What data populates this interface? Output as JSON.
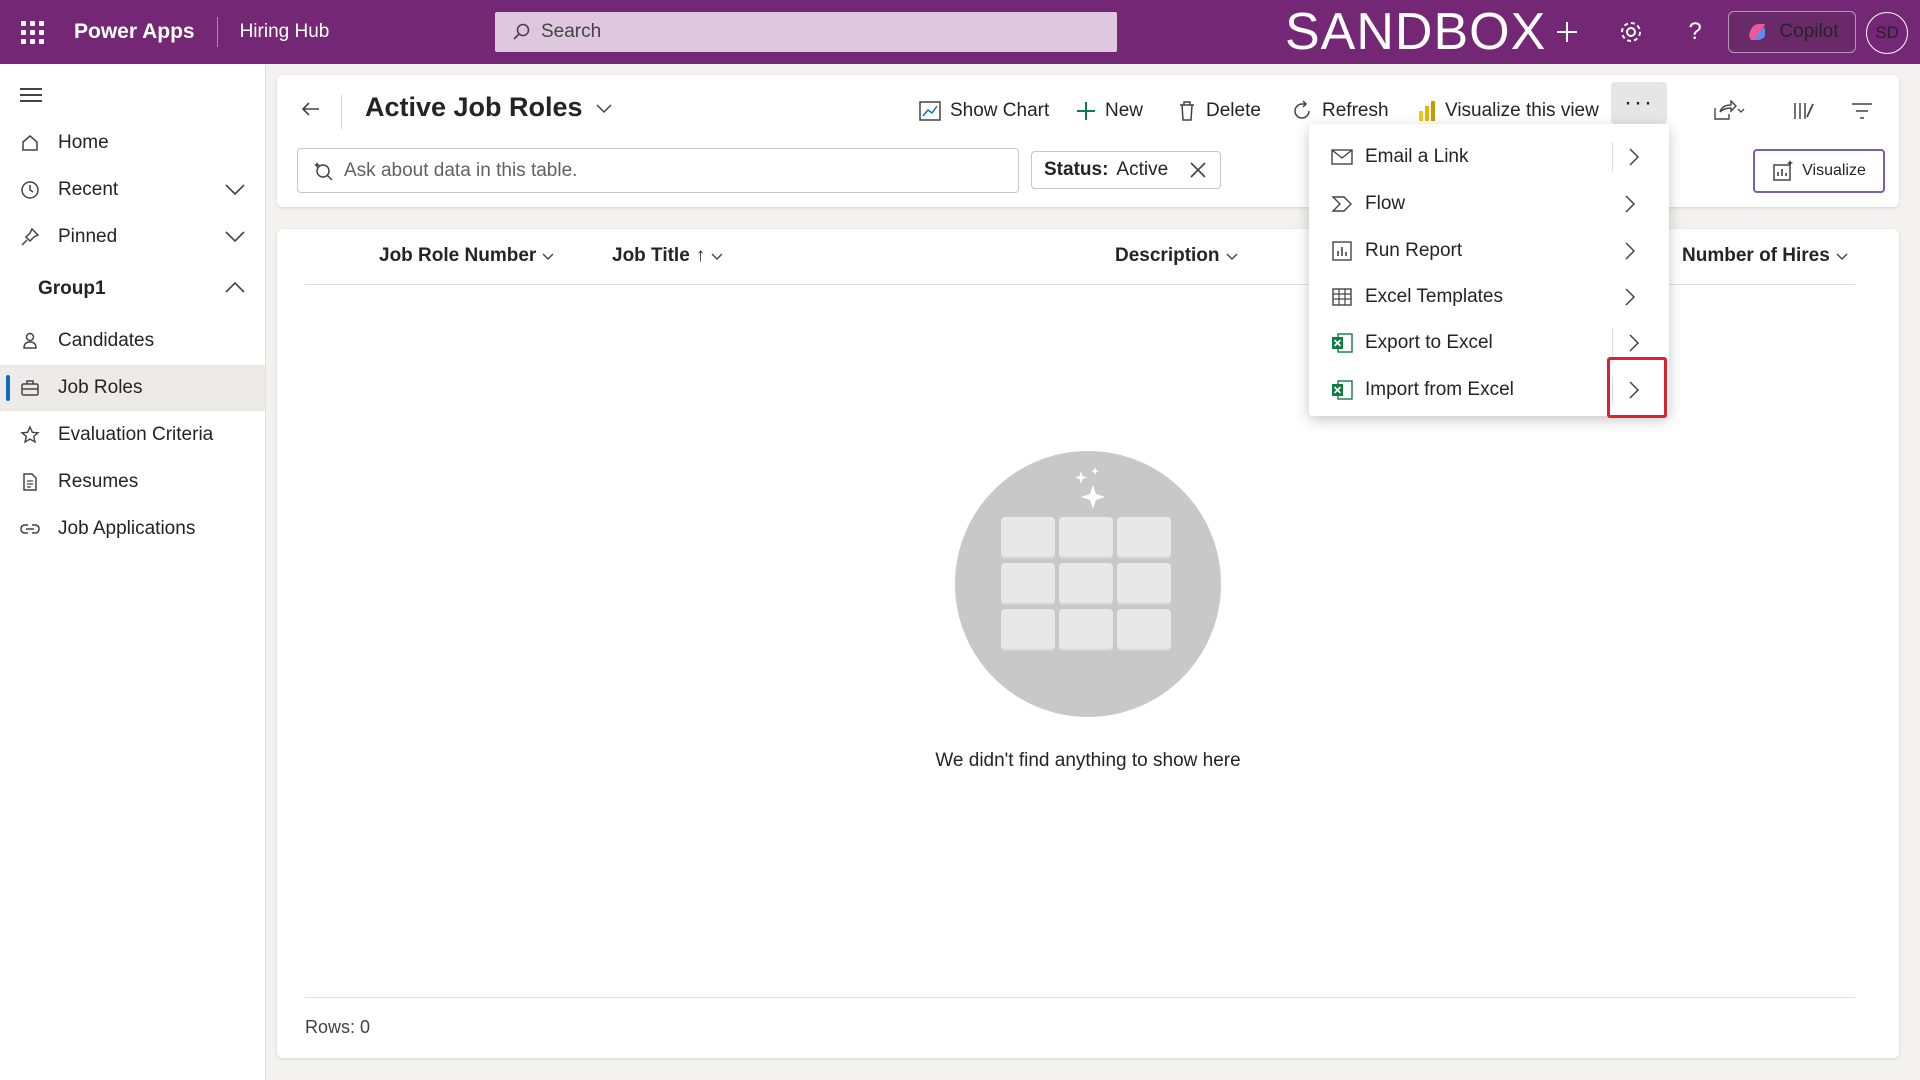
{
  "topbar": {
    "brand": "Power Apps",
    "app_name": "Hiring Hub",
    "search_placeholder": "Search",
    "environment_label": "SANDBOX",
    "copilot_label": "Copilot",
    "user_initials": "SD"
  },
  "sidebar": {
    "items": [
      {
        "label": "Home",
        "icon": "home-icon"
      },
      {
        "label": "Recent",
        "icon": "clock-icon"
      },
      {
        "label": "Pinned",
        "icon": "pin-icon"
      }
    ],
    "group_label": "Group1",
    "group_items": [
      {
        "label": "Candidates",
        "icon": "person-icon"
      },
      {
        "label": "Job Roles",
        "icon": "briefcase-icon",
        "active": true
      },
      {
        "label": "Evaluation Criteria",
        "icon": "star-icon"
      },
      {
        "label": "Resumes",
        "icon": "document-icon"
      },
      {
        "label": "Job Applications",
        "icon": "link-icon"
      }
    ]
  },
  "view": {
    "title": "Active Job Roles",
    "commands": {
      "show_chart": "Show Chart",
      "new": "New",
      "delete": "Delete",
      "refresh": "Refresh",
      "visualize_view": "Visualize this view",
      "more": "···"
    },
    "ask_placeholder": "Ask about data in this table.",
    "filter": {
      "key": "Status:",
      "value": "Active"
    },
    "visualize_label": "Visualize"
  },
  "grid": {
    "columns": [
      "Job Role Number",
      "Job Title",
      "Description",
      "Number of Hires"
    ],
    "sort_indicator": "↑",
    "empty_message": "We didn't find anything to show here",
    "rows_label": "Rows: 0"
  },
  "menu": {
    "items": [
      {
        "label": "Email a Link",
        "icon": "email-link-icon"
      },
      {
        "label": "Flow",
        "icon": "flow-icon"
      },
      {
        "label": "Run Report",
        "icon": "report-icon"
      },
      {
        "label": "Excel Templates",
        "icon": "excel-template-icon"
      },
      {
        "label": "Export to Excel",
        "icon": "excel-icon"
      },
      {
        "label": "Import from Excel",
        "icon": "excel-icon"
      }
    ]
  },
  "colors": {
    "topbar": "#742774",
    "accent": "#0f6cbd",
    "highlight": "#e0202e",
    "excel_green": "#107c41"
  }
}
